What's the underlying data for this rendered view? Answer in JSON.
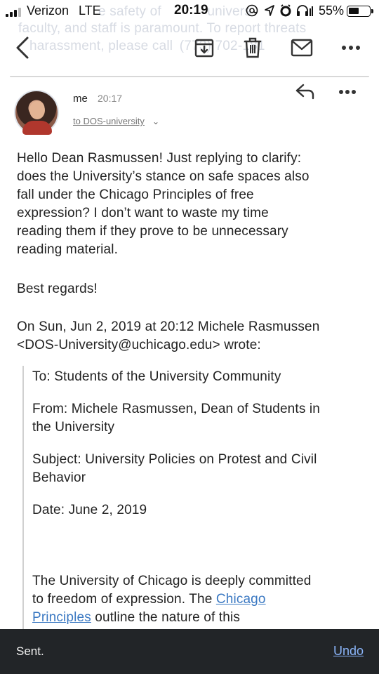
{
  "background_text": {
    "line1": "e safety of",
    "line1b": "univers",
    "line2": "faculty, and staff is paramount. To report threats",
    "line3": "harassment, please call",
    "line3b": "(773) 702-181"
  },
  "status_bar": {
    "carrier": "Verizon",
    "network": "LTE",
    "time": "20:19",
    "battery_percent": "55%",
    "battery_level": 0.55,
    "icons": [
      "at-sign-icon",
      "location-arrow-icon",
      "alarm-icon",
      "headphones-icon"
    ]
  },
  "toolbar": {
    "actions": [
      "back",
      "archive",
      "delete",
      "mark-unread",
      "more"
    ]
  },
  "message": {
    "sender": "me",
    "time": "20:17",
    "recipients": "to DOS-university",
    "body_lines": [
      "Hello Dean Rasmussen! Just replying to clarify:",
      "does the University’s stance on safe spaces also",
      "fall under the Chicago Principles of free",
      "expression? I don’t want to waste my time",
      "reading them if they prove to be unnecessary",
      "reading material."
    ],
    "signoff": "Best regards!",
    "quote_header_lines": [
      "On Sun, Jun 2, 2019 at 20:12 Michele Rasmussen",
      "<DOS-University@uchicago.edu> wrote:"
    ],
    "quoted": {
      "to": "To: Students of the University Community",
      "from_lines": [
        "From: Michele Rasmussen, Dean of Students in",
        "the University"
      ],
      "subject_lines": [
        "Subject: University Policies on Protest and Civil",
        "Behavior"
      ],
      "date": "Date: June 2, 2019",
      "intro_line1": "The University of Chicago is deeply committed",
      "intro_line2_pre": "to freedom of expression. The ",
      "intro_link_part1": "Chicago",
      "intro_link_part2": "Principles",
      "intro_line3_post": " outline the nature of this"
    }
  },
  "snackbar": {
    "message": "Sent.",
    "action": "Undo"
  },
  "colors": {
    "link": "#3a78c2",
    "snackbar_bg": "#222528",
    "snackbar_action": "#8ab4f8"
  }
}
